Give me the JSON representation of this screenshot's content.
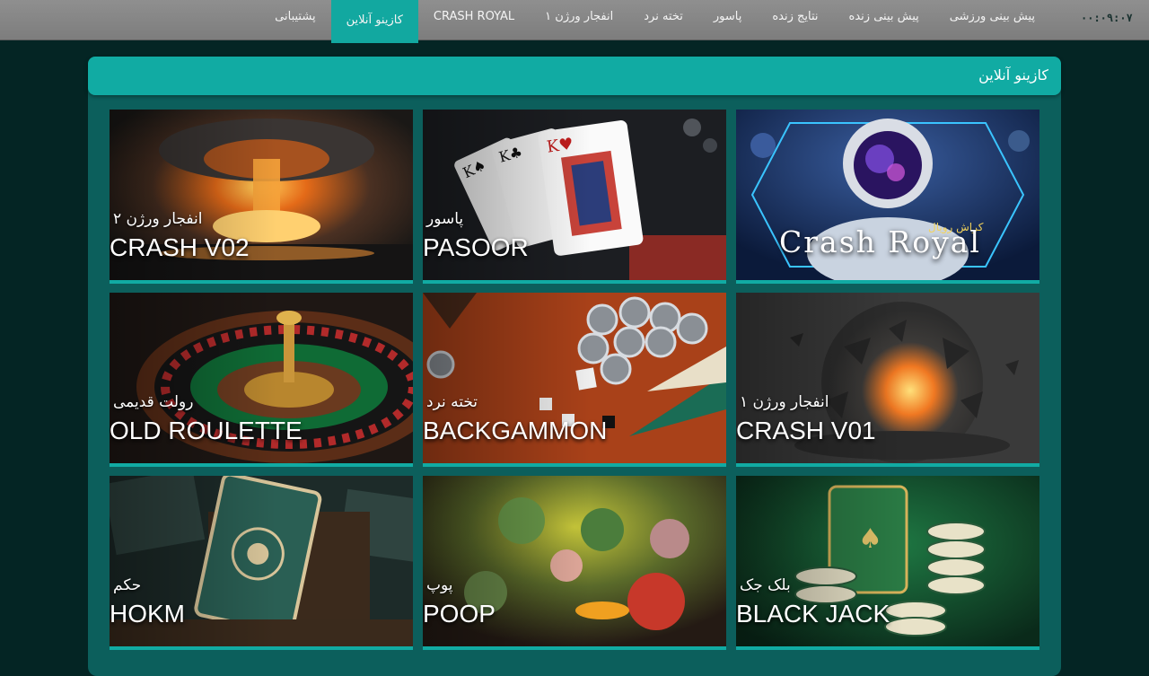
{
  "clock": "۰۰:۰۹:۰۷",
  "nav": {
    "items": [
      {
        "label": "پیش بینی ورزشی"
      },
      {
        "label": "پیش بینی زنده"
      },
      {
        "label": "نتایج زنده"
      },
      {
        "label": "پاسور"
      },
      {
        "label": "تخته نرد"
      },
      {
        "label": "انفجار ورژن ۱"
      },
      {
        "label": "CRASH ROYAL"
      },
      {
        "label": "کازینو آنلاین"
      },
      {
        "label": "پشتیبانی"
      }
    ],
    "active": "کازینو آنلاین"
  },
  "panel": {
    "title": "کازینو آنلاین"
  },
  "games": [
    {
      "fa": "انفجار ورژن ۲",
      "en": "CRASH V02",
      "icon": "nuclear-explosion-art"
    },
    {
      "fa": "پاسور",
      "en": "PASOOR",
      "icon": "playing-cards-art"
    },
    {
      "fa": "کراش رویال",
      "en": "Crash Royal",
      "icon": "astronaut-art"
    },
    {
      "fa": "رولت قدیمی",
      "en": "OLD ROULETTE",
      "icon": "roulette-wheel-art"
    },
    {
      "fa": "تخته نرد",
      "en": "BACKGAMMON",
      "icon": "backgammon-board-art"
    },
    {
      "fa": "انفجار ورژن ۱",
      "en": "CRASH V01",
      "icon": "explosion-art"
    },
    {
      "fa": "حکم",
      "en": "HOKM",
      "icon": "card-deck-art"
    },
    {
      "fa": "پوپ",
      "en": "POOP",
      "icon": "cartoon-monsters-art"
    },
    {
      "fa": "بلک جک",
      "en": "BLACK JACK",
      "icon": "blackjack-chips-art"
    }
  ],
  "colors": {
    "accent": "#11aba3",
    "background": "#042524",
    "panel": "#0c5f5c",
    "topbar": "#8a8a8a"
  }
}
